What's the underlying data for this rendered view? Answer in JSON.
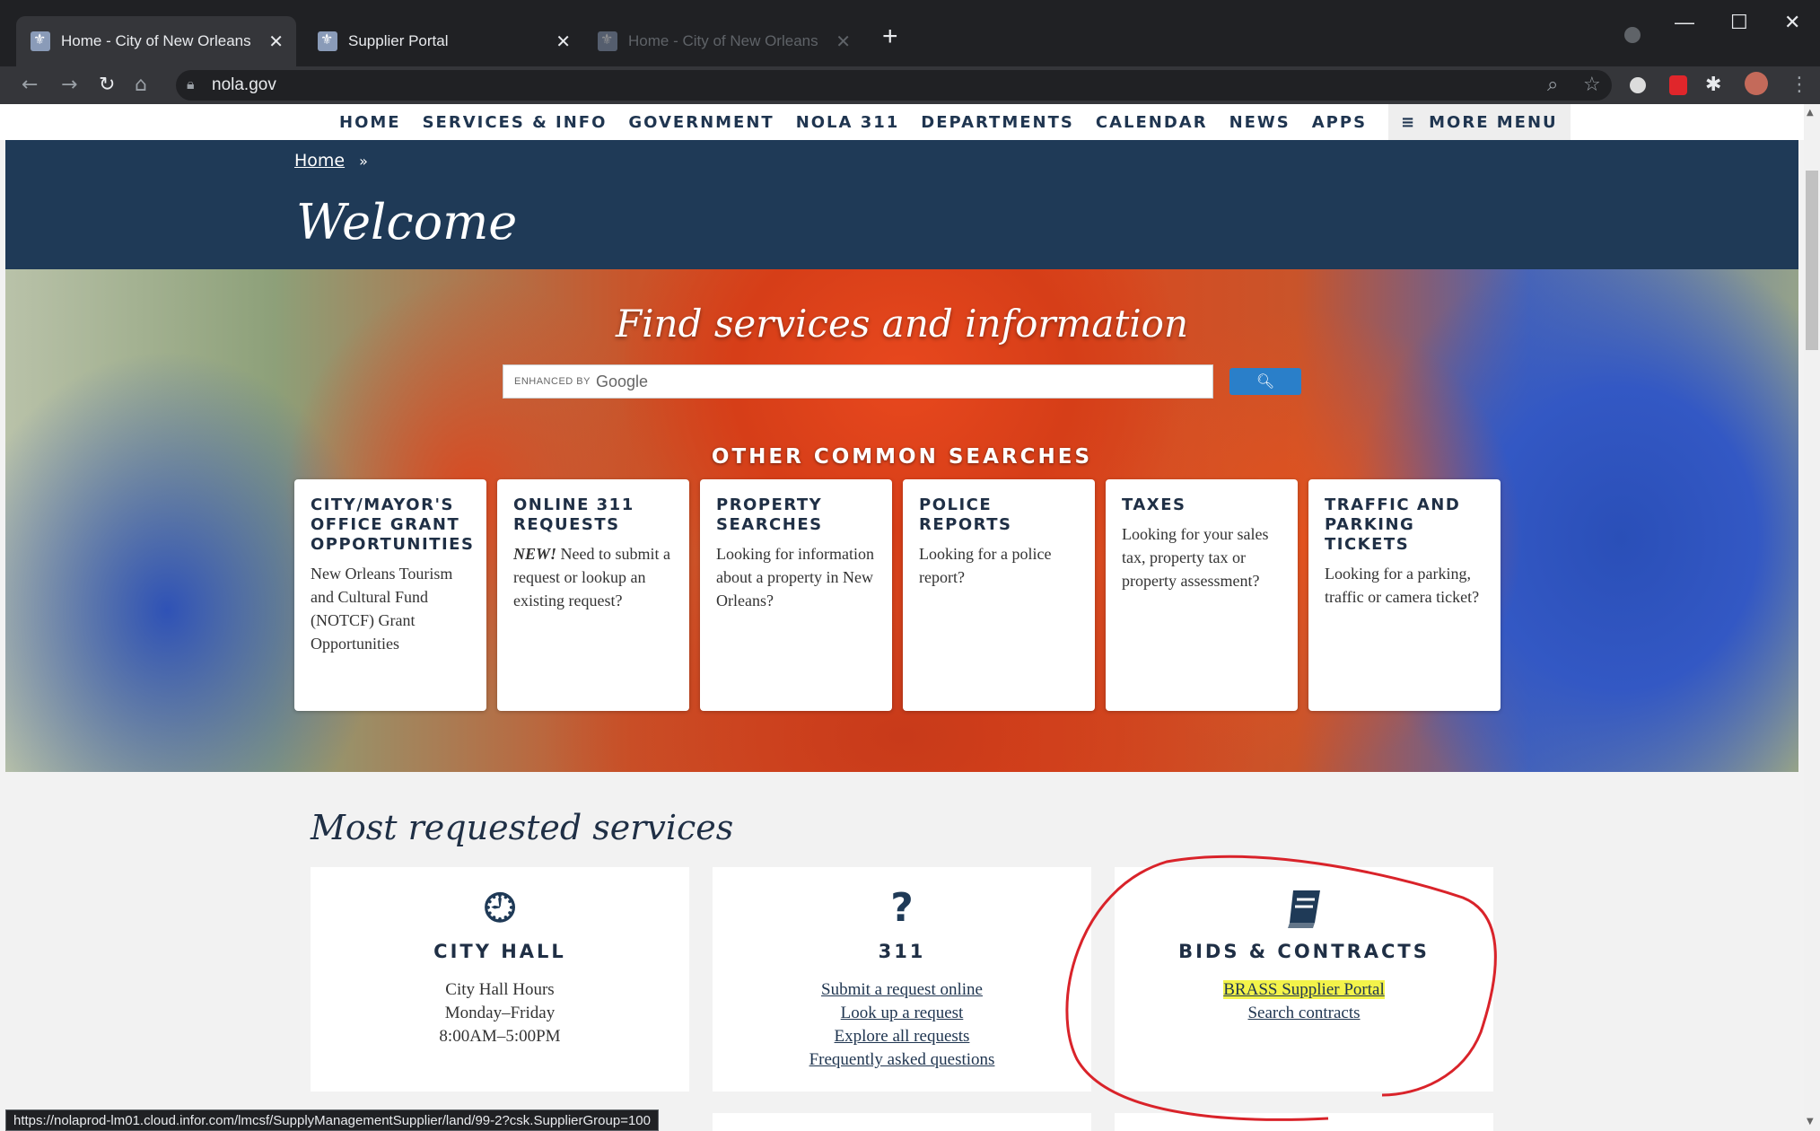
{
  "browser": {
    "tabs": [
      {
        "title": "Home - City of New Orleans",
        "active": true
      },
      {
        "title": "Supplier Portal",
        "active": false
      },
      {
        "title": "Home - City of New Orleans",
        "active": false
      }
    ],
    "url": "nola.gov",
    "status_url": "https://nolaprod-lm01.cloud.infor.com/lmcsf/SupplyManagementSupplier/land/99-2?csk.SupplierGroup=100"
  },
  "nav": {
    "items": [
      "HOME",
      "SERVICES & INFO",
      "GOVERNMENT",
      "NOLA 311",
      "DEPARTMENTS",
      "CALENDAR",
      "NEWS",
      "APPS"
    ],
    "more": "MORE MENU"
  },
  "header": {
    "breadcrumb": "Home",
    "breadcrumb_sep": "»",
    "title": "Welcome"
  },
  "hero": {
    "title": "Find services and information",
    "search_enhanced": "ENHANCED BY",
    "search_brand": "Google",
    "other_title": "OTHER COMMON SEARCHES",
    "cards": [
      {
        "title": "CITY/MAYOR'S OFFICE GRANT OPPORTUNITIES",
        "new": "",
        "text": "New Orleans Tourism and Cultural Fund (NOTCF) Grant Opportunities"
      },
      {
        "title": "ONLINE 311 REQUESTS",
        "new": "NEW!",
        "text": "Need to submit a request or lookup an existing request?"
      },
      {
        "title": "PROPERTY SEARCHES",
        "new": "",
        "text": "Looking for information about a property in New Orleans?"
      },
      {
        "title": "POLICE REPORTS",
        "new": "",
        "text": "Looking for a police report?"
      },
      {
        "title": "TAXES",
        "new": "",
        "text": "Looking for your sales tax, property tax or property assessment?"
      },
      {
        "title": "TRAFFIC AND PARKING TICKETS",
        "new": "",
        "text": "Looking for a parking, traffic or camera ticket?"
      }
    ]
  },
  "most_requested": {
    "title": "Most requested services",
    "city_hall": {
      "title": "CITY HALL",
      "lines": [
        "City Hall Hours",
        "Monday–Friday",
        "8:00AM–5:00PM"
      ]
    },
    "nola311": {
      "title": "311",
      "links": [
        "Submit a request online",
        "Look up a request",
        "Explore all requests",
        "Frequently asked questions"
      ]
    },
    "bids": {
      "title": "BIDS & CONTRACTS",
      "links": [
        "BRASS Supplier Portal",
        "Search contracts"
      ]
    }
  },
  "colors": {
    "navy": "#1f3a57",
    "highlight": "#f3f34a",
    "annotation": "#d9232a"
  }
}
